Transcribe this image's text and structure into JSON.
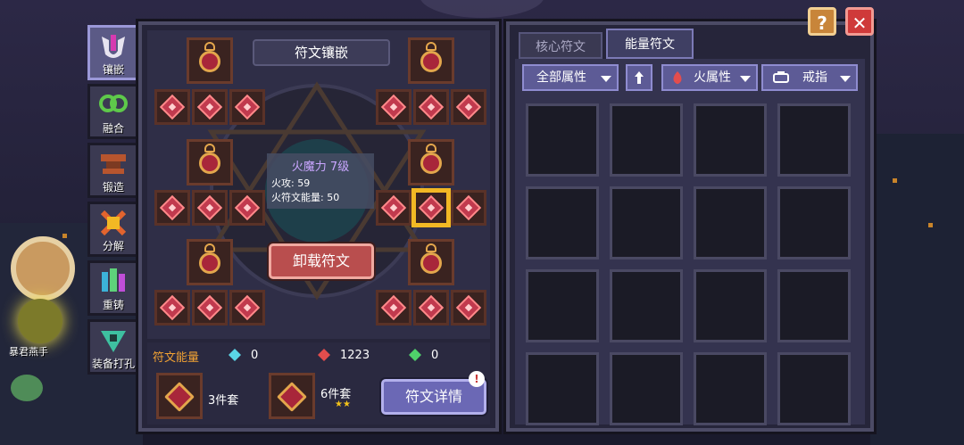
{
  "side_tabs": [
    {
      "label": "镶嵌",
      "icon": "rune-inlay-icon",
      "active": true
    },
    {
      "label": "融合",
      "icon": "fusion-rings-icon",
      "active": false
    },
    {
      "label": "锻造",
      "icon": "forge-anvil-icon",
      "active": false
    },
    {
      "label": "分解",
      "icon": "decompose-cross-icon",
      "active": false
    },
    {
      "label": "重铸",
      "icon": "recast-crystal-icon",
      "active": false
    },
    {
      "label": "装备打孔",
      "icon": "socket-drill-icon",
      "active": false
    }
  ],
  "left_panel": {
    "title": "符文镶嵌",
    "tooltip": {
      "name": "火魔力 7级",
      "line1": "火攻: 59",
      "line2": "火符文能量: 50"
    },
    "unload_button": "卸载符文",
    "energy": {
      "label": "符文能量",
      "values": [
        "0",
        "1223",
        "0"
      ]
    },
    "sets": [
      {
        "label": "3件套"
      },
      {
        "label": "6件套",
        "stars": "★★"
      }
    ],
    "detail_button": "符文详情",
    "detail_badge": "!"
  },
  "bg_text": "暴君燕手",
  "right_panel": {
    "tabs": [
      {
        "label": "核心符文",
        "active": false
      },
      {
        "label": "能量符文",
        "active": true
      }
    ],
    "filters": {
      "all_attr": "全部属性",
      "sort_icon": "arrow-up-icon",
      "element": "火属性",
      "slot": "戒指"
    },
    "grid_rows": 4,
    "grid_cols": 4
  },
  "corner": {
    "help": "?",
    "close": "✕"
  },
  "colors": {
    "accent_gold": "#f2b824",
    "rune_red": "#c13a4e",
    "panel": "#26253a"
  }
}
